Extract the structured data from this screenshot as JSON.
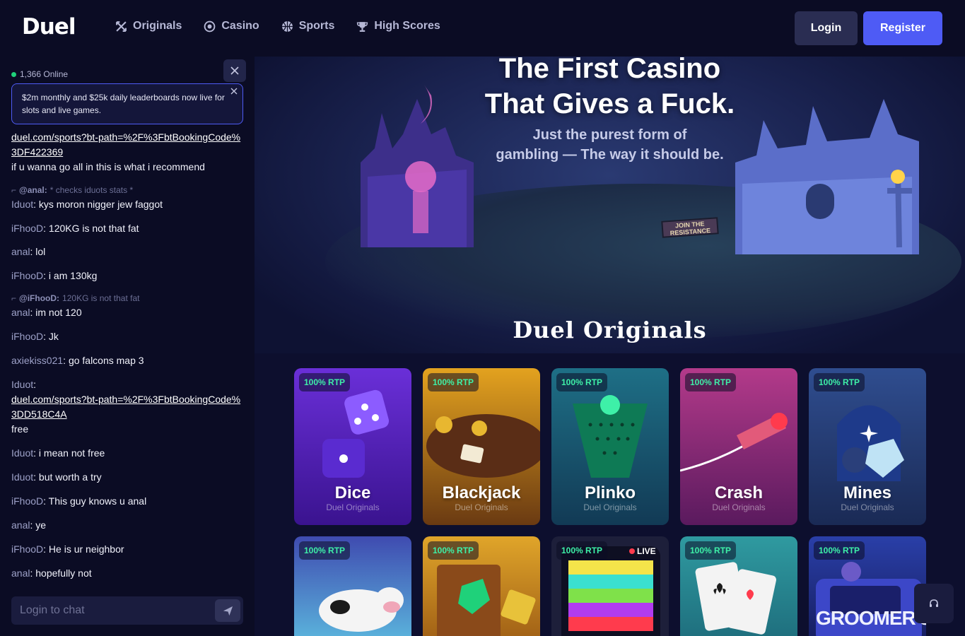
{
  "header": {
    "logo": "Duel",
    "nav": [
      {
        "label": "Originals",
        "icon": "crossed-swords-icon"
      },
      {
        "label": "Casino",
        "icon": "casino-chip-icon"
      },
      {
        "label": "Sports",
        "icon": "basketball-icon"
      },
      {
        "label": "High Scores",
        "icon": "trophy-icon"
      }
    ],
    "login": "Login",
    "register": "Register"
  },
  "chat": {
    "online": "1,366 Online",
    "banner": "$2m monthly and $25k daily leaderboards now live for slots and live games.",
    "messages": {
      "m1_link": "duel.com/sports?bt-path=%2F%3FbtBookingCode%3DF422369",
      "m1_text": "if u wanna go all in this is what i recommend",
      "r1_user": "@anal:",
      "r1_text": "* checks iduots stats *",
      "m2_user": "Iduot",
      "m2_text": "kys moron nigger jew faggot",
      "m3_user": "iFhooD",
      "m3_text": "120KG is not that fat",
      "m4_user": "anal",
      "m4_text": "lol",
      "m5_user": "iFhooD",
      "m5_text": "i am 130kg",
      "r2_user": "@iFhooD:",
      "r2_text": "120KG is not that fat",
      "m6_user": "anal",
      "m6_text": "im not 120",
      "m7_user": "iFhooD",
      "m7_text": "Jk",
      "m8_user": "axiekiss021",
      "m8_text": "go falcons map 3",
      "m9_user": "Iduot",
      "m9_link": "duel.com/sports?bt-path=%2F%3FbtBookingCode%3DD518C4A",
      "m9_text": "free",
      "m10_user": "Iduot",
      "m10_text": "i mean not free",
      "m11_user": "Iduot",
      "m11_text": "but worth a try",
      "m12_user": "iFhooD",
      "m12_text": "This guy knows u anal",
      "m13_user": "anal",
      "m13_text": "ye",
      "m14_user": "iFhooD",
      "m14_text": "He is ur neighbor",
      "m15_user": "anal",
      "m15_text": "hopefully not"
    },
    "input_placeholder": "Login to chat"
  },
  "hero": {
    "title_line1": "The First Casino",
    "title_line2": "That Gives a Fuck.",
    "subtitle_line1": "Just the purest form of",
    "subtitle_line2": "gambling — The way it should be.",
    "sign_text": "JOIN THE RESISTANCE"
  },
  "originals": {
    "section_title": "Duel Originals",
    "rtp_label": "100% RTP",
    "games": [
      {
        "name": "Dice",
        "sub": "Duel Originals",
        "color1": "#6a2fd8",
        "color2": "#3a138f"
      },
      {
        "name": "Blackjack",
        "sub": "Duel Originals",
        "color1": "#e3a21f",
        "color2": "#6a3a12"
      },
      {
        "name": "Plinko",
        "sub": "Duel Originals",
        "color1": "#1e6f86",
        "color2": "#123a55"
      },
      {
        "name": "Crash",
        "sub": "Duel Originals",
        "color1": "#b33a8a",
        "color2": "#5a1a5e"
      },
      {
        "name": "Mines",
        "sub": "Duel Originals",
        "color1": "#2f4d8f",
        "color2": "#1a2a55"
      }
    ],
    "row2": [
      {
        "color1": "#3f4bb0",
        "color2": "#5dbde0",
        "live": ""
      },
      {
        "color1": "#e0a52a",
        "color2": "#9b5a14",
        "live": ""
      },
      {
        "color1": "#1d1f3a",
        "color2": "#2b2f5a",
        "live": "LIVE"
      },
      {
        "color1": "#2f9aa0",
        "color2": "#1d6a7a",
        "live": ""
      },
      {
        "color1": "#2a3fa8",
        "color2": "#141b5a",
        "live": "",
        "art_text": "GROOMER'S"
      }
    ]
  }
}
